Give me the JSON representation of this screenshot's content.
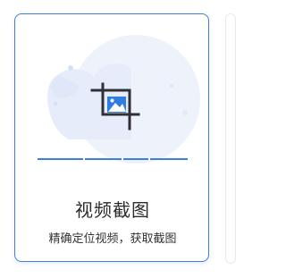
{
  "card": {
    "title": "视频截图",
    "description": "精确定位视频，获取截图",
    "icon": "crop-image-icon",
    "accent_color": "#3d7fe0"
  }
}
